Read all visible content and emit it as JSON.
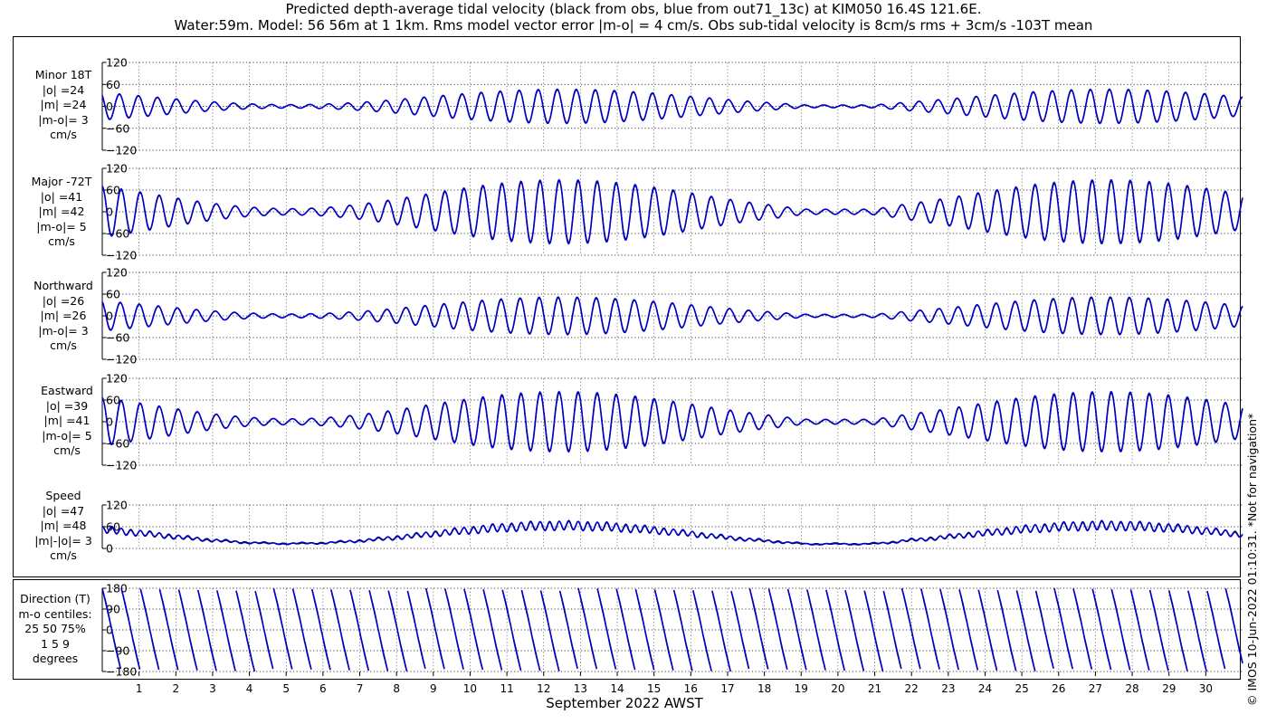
{
  "title_line1": "Predicted depth-average tidal velocity (black from obs, blue from out71_13c) at KIM050 16.4S 121.6E.",
  "title_line2": "Water:59m. Model: 56 56m at 1 1km. Rms model vector error |m-o| = 4 cm/s. Obs sub-tidal velocity is 8cm/s rms + 3cm/s -103T mean",
  "xlabel": "September 2022 AWST",
  "credit": "© IMOS 10-Jun-2022 01:10:31. *Not for navigation*",
  "colors": {
    "obs": "#000000",
    "model": "#0000cc",
    "grid": "#777777"
  },
  "chart_data": [
    {
      "type": "line",
      "panel": "minor",
      "labels": [
        "Minor 18T",
        "|o| =24",
        "|m| =24",
        "|m-o|= 3",
        "cm/s"
      ],
      "ylim": [
        -120,
        120
      ],
      "yticks": [
        -120,
        -60,
        0,
        60,
        120
      ],
      "x_ticks": [
        "1",
        "2",
        "3",
        "4",
        "5",
        "6",
        "7",
        "8",
        "9",
        "10",
        "11",
        "12",
        "13",
        "14",
        "15",
        "16",
        "17",
        "18",
        "19",
        "20",
        "21",
        "22",
        "23",
        "24",
        "25",
        "26",
        "27",
        "28",
        "29",
        "30"
      ],
      "series": [
        {
          "name": "obs"
        },
        {
          "name": "model"
        }
      ],
      "amplitude": 45
    },
    {
      "type": "line",
      "panel": "major",
      "labels": [
        "Major -72T",
        "|o| =41",
        "|m| =42",
        "|m-o|= 5",
        "cm/s"
      ],
      "ylim": [
        -120,
        120
      ],
      "yticks": [
        -120,
        -60,
        0,
        60,
        120
      ],
      "x_ticks": [
        "1",
        "2",
        "3",
        "4",
        "5",
        "6",
        "7",
        "8",
        "9",
        "10",
        "11",
        "12",
        "13",
        "14",
        "15",
        "16",
        "17",
        "18",
        "19",
        "20",
        "21",
        "22",
        "23",
        "24",
        "25",
        "26",
        "27",
        "28",
        "29",
        "30"
      ],
      "series": [
        {
          "name": "obs"
        },
        {
          "name": "model"
        }
      ],
      "amplitude": 85
    },
    {
      "type": "line",
      "panel": "northward",
      "labels": [
        "Northward",
        "|o| =26",
        "|m| =26",
        "|m-o|= 3",
        "cm/s"
      ],
      "ylim": [
        -120,
        120
      ],
      "yticks": [
        -120,
        -60,
        0,
        60,
        120
      ],
      "x_ticks": [
        "1",
        "2",
        "3",
        "4",
        "5",
        "6",
        "7",
        "8",
        "9",
        "10",
        "11",
        "12",
        "13",
        "14",
        "15",
        "16",
        "17",
        "18",
        "19",
        "20",
        "21",
        "22",
        "23",
        "24",
        "25",
        "26",
        "27",
        "28",
        "29",
        "30"
      ],
      "series": [
        {
          "name": "obs"
        },
        {
          "name": "model"
        }
      ],
      "amplitude": 50
    },
    {
      "type": "line",
      "panel": "eastward",
      "labels": [
        "Eastward",
        "|o| =39",
        "|m| =41",
        "|m-o|= 5",
        "cm/s"
      ],
      "ylim": [
        -120,
        120
      ],
      "yticks": [
        -120,
        -60,
        0,
        60,
        120
      ],
      "x_ticks": [
        "1",
        "2",
        "3",
        "4",
        "5",
        "6",
        "7",
        "8",
        "9",
        "10",
        "11",
        "12",
        "13",
        "14",
        "15",
        "16",
        "17",
        "18",
        "19",
        "20",
        "21",
        "22",
        "23",
        "24",
        "25",
        "26",
        "27",
        "28",
        "29",
        "30"
      ],
      "series": [
        {
          "name": "obs"
        },
        {
          "name": "model"
        }
      ],
      "amplitude": 80
    },
    {
      "type": "line",
      "panel": "speed",
      "labels": [
        "Speed",
        "|o| =47",
        "|m| =48",
        "|m|-|o|= 3",
        "cm/s"
      ],
      "ylim": [
        0,
        120
      ],
      "yticks": [
        0,
        60,
        120
      ],
      "x_ticks": [
        "1",
        "2",
        "3",
        "4",
        "5",
        "6",
        "7",
        "8",
        "9",
        "10",
        "11",
        "12",
        "13",
        "14",
        "15",
        "16",
        "17",
        "18",
        "19",
        "20",
        "21",
        "22",
        "23",
        "24",
        "25",
        "26",
        "27",
        "28",
        "29",
        "30"
      ],
      "series": [
        {
          "name": "obs"
        },
        {
          "name": "model"
        }
      ],
      "amplitude": 85
    },
    {
      "type": "line",
      "panel": "direction",
      "labels": [
        "Direction (T)",
        "m-o centiles:",
        "25  50  75%",
        "1   5   9",
        "degrees"
      ],
      "ylim": [
        -180,
        180
      ],
      "yticks": [
        -180,
        -90,
        0,
        90,
        180
      ],
      "x_ticks": [
        "1",
        "2",
        "3",
        "4",
        "5",
        "6",
        "7",
        "8",
        "9",
        "10",
        "11",
        "12",
        "13",
        "14",
        "15",
        "16",
        "17",
        "18",
        "19",
        "20",
        "21",
        "22",
        "23",
        "24",
        "25",
        "26",
        "27",
        "28",
        "29",
        "30"
      ],
      "series": [
        {
          "name": "obs"
        },
        {
          "name": "model"
        }
      ]
    }
  ]
}
